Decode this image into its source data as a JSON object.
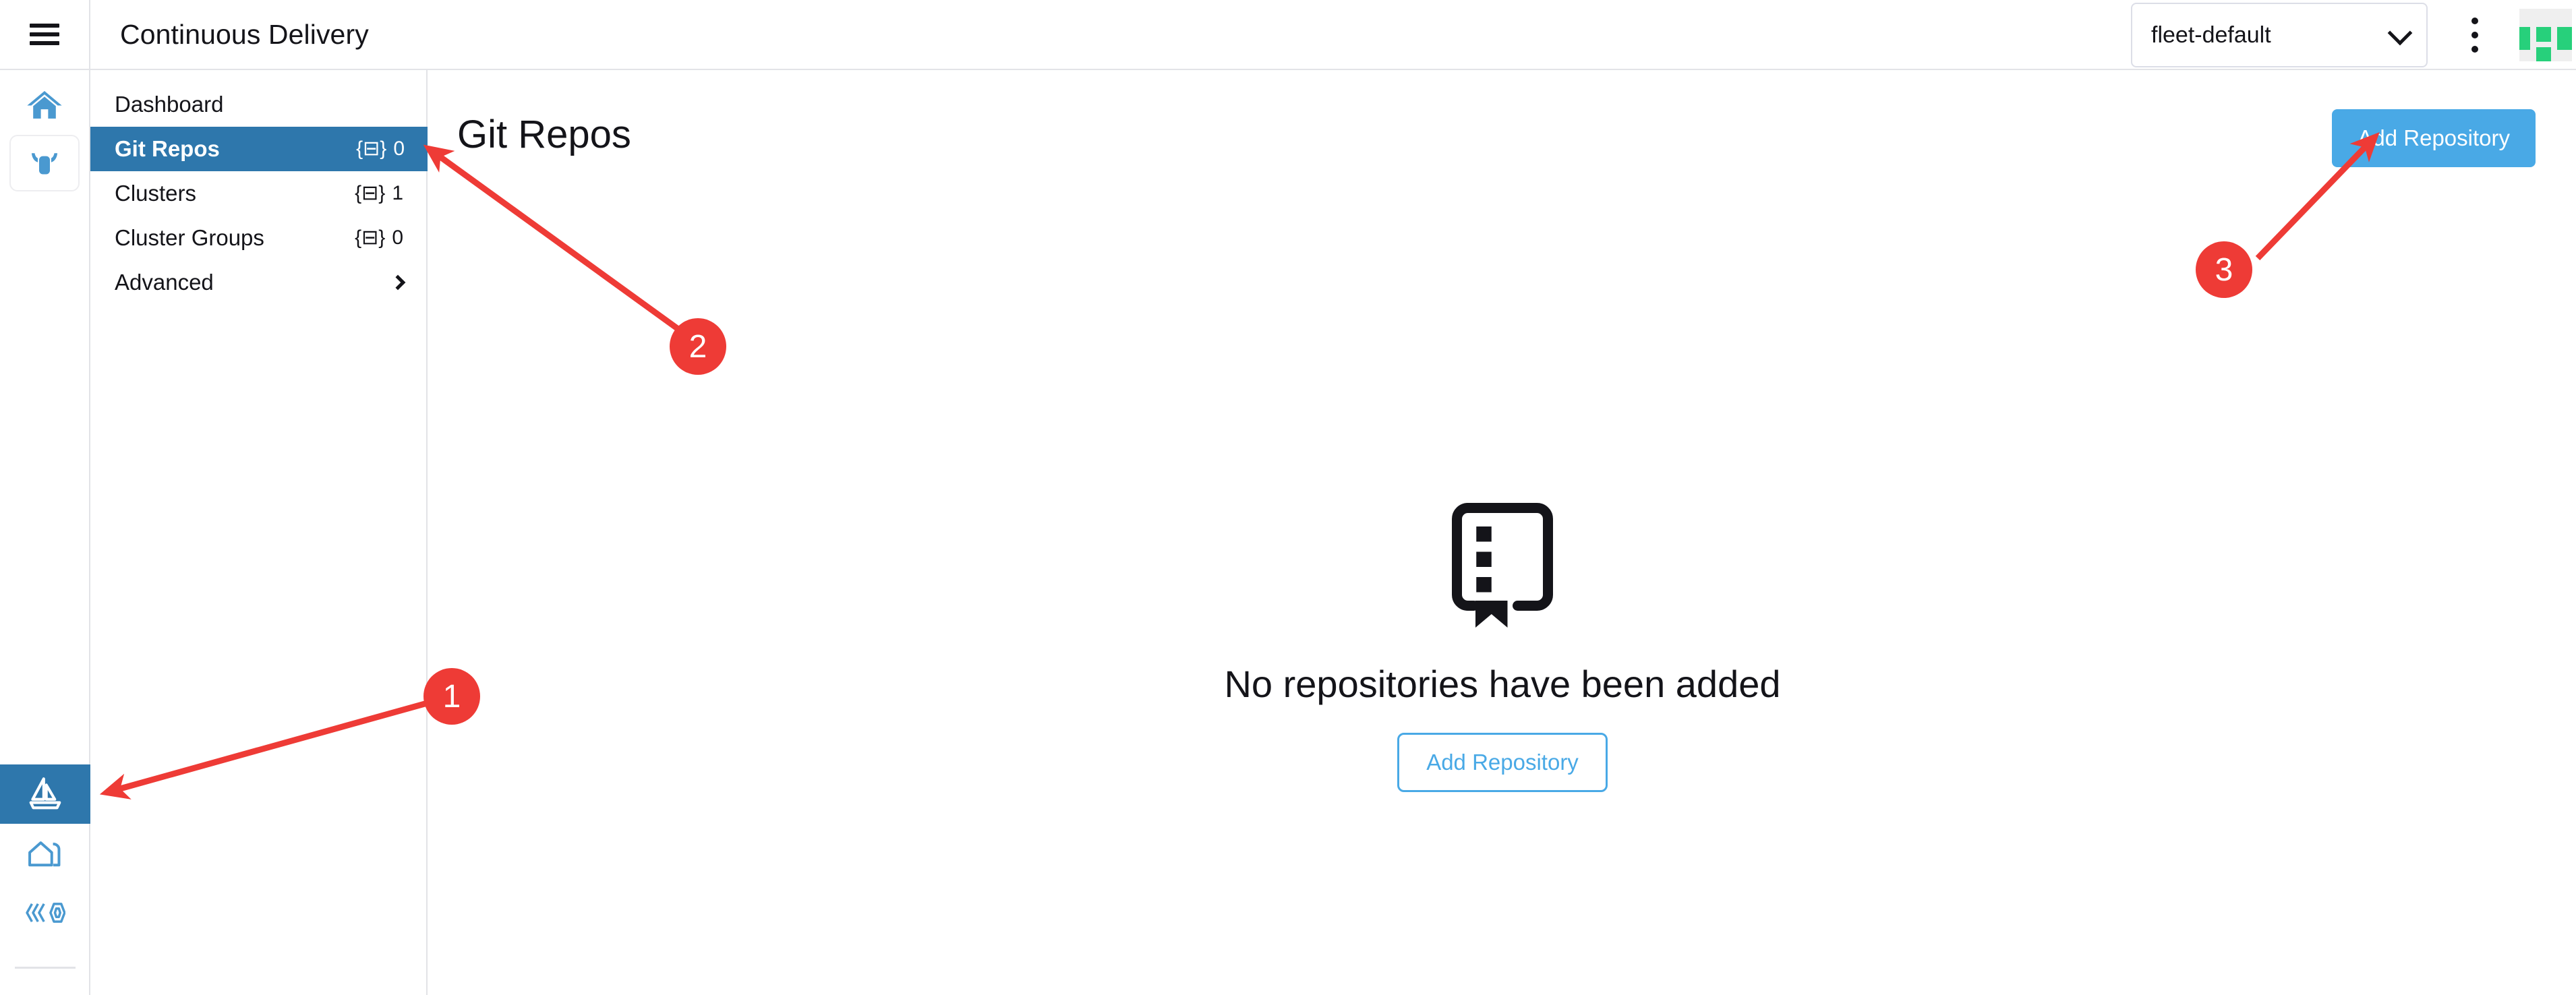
{
  "topbar": {
    "menu_icon": "hamburger-menu-icon",
    "title": "Continuous Delivery",
    "namespace_select": {
      "value": "fleet-default",
      "icon": "chevron-down-icon"
    },
    "kebab_icon": "kebab-menu-icon",
    "logo": "rancher-logo"
  },
  "rail": {
    "items": [
      {
        "icon": "home-icon",
        "active": false
      },
      {
        "icon": "cluster-cow-icon",
        "active": false
      },
      {
        "icon": "sailboat-fleet-icon",
        "active": true
      },
      {
        "icon": "barn-cluster-explorer-icon",
        "active": false
      },
      {
        "icon": "hexagon-mesh-icon",
        "active": false
      }
    ]
  },
  "sidebar": {
    "items": [
      {
        "label": "Dashboard",
        "badge": "",
        "count": "",
        "selected": false,
        "chevron": false
      },
      {
        "label": "Git Repos",
        "badge": "{⊟}",
        "count": "0",
        "selected": true,
        "chevron": false
      },
      {
        "label": "Clusters",
        "badge": "{⊟}",
        "count": "1",
        "selected": false,
        "chevron": false
      },
      {
        "label": "Cluster Groups",
        "badge": "{⊟}",
        "count": "0",
        "selected": false,
        "chevron": false
      },
      {
        "label": "Advanced",
        "badge": "",
        "count": "",
        "selected": false,
        "chevron": true
      }
    ]
  },
  "main": {
    "page_title": "Git Repos",
    "add_repository_button": "Add Repository",
    "empty_state": {
      "icon": "repository-bookmark-icon",
      "message": "No repositories have been added",
      "action_label": "Add Repository"
    }
  },
  "annotations": {
    "color": "#ee3b36",
    "markers": [
      {
        "number": "1",
        "target": "sailboat-fleet-icon"
      },
      {
        "number": "2",
        "target": "sidebar-item-git-repos"
      },
      {
        "number": "3",
        "target": "add-repository-button"
      }
    ]
  },
  "colors": {
    "accent_blue": "#49a9e6",
    "selected_blue": "#2e77ac",
    "annotation_red": "#ee3b36",
    "logo_green": "#27d07b",
    "border_gray": "#e2e3e7"
  }
}
